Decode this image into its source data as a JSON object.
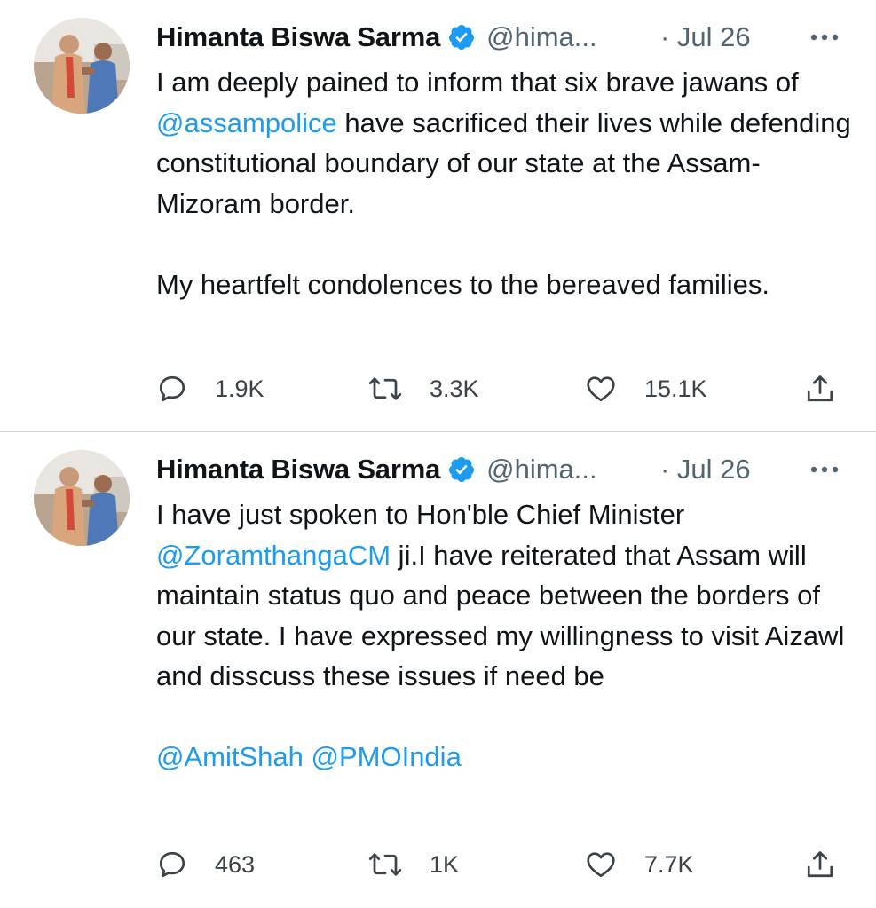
{
  "tweets": [
    {
      "author_name": "Himanta Biswa Sarma",
      "handle": "@hima...",
      "date": "· Jul 26",
      "text": {
        "p1_before": "I am deeply pained to inform that six brave jawans of ",
        "mention": "@assampolice",
        "p1_after": " have sacrificed their lives while defending constitutional boundary of our state at the Assam-Mizoram border.",
        "p2": "My heartfelt condolences to the bereaved families."
      },
      "stats": {
        "replies": "1.9K",
        "retweets": "3.3K",
        "likes": "15.1K"
      }
    },
    {
      "author_name": "Himanta Biswa Sarma",
      "handle": "@hima...",
      "date": "· Jul 26",
      "text": {
        "p1_before": "I have just spoken to Hon'ble Chief Minister ",
        "mention": "@ZoramthangaCM",
        "p1_after": " ji.I have reiterated that Assam will maintain status quo and peace between the borders of our state. I have expressed my willingness to visit Aizawl and disscuss these issues if need be",
        "mention2": "@AmitShah",
        "mention3": "@PMOIndia"
      },
      "stats": {
        "replies": "463",
        "retweets": "1K",
        "likes": "7.7K"
      }
    }
  ],
  "colors": {
    "link": "#1d9bf0",
    "verified": "#1d9bf0",
    "secondary_text": "#536471"
  },
  "icons": [
    "verified-badge-icon",
    "more-icon",
    "reply-icon",
    "retweet-icon",
    "like-icon",
    "share-icon"
  ]
}
